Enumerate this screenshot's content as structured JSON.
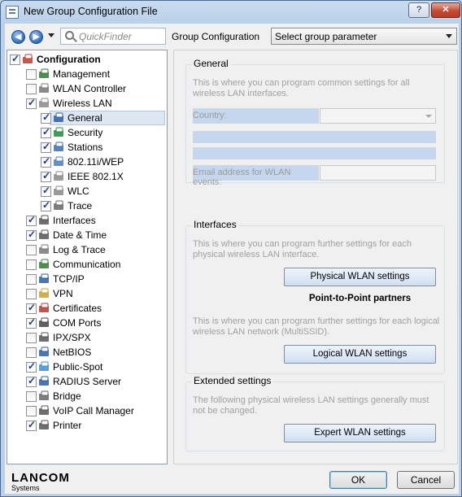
{
  "window": {
    "title": "New Group Configuration File",
    "help_label": "?",
    "close_label": "✕"
  },
  "toolbar": {
    "back_label": "◀",
    "forward_label": "▶",
    "quickfinder_placeholder": "QuickFinder",
    "group_label": "Group Configuration",
    "group_select_value": "Select group parameter"
  },
  "tree": {
    "items": [
      {
        "label": "Configuration",
        "checked": true,
        "icon": "configuration-icon",
        "bold": true,
        "level": 0
      },
      {
        "label": "Management",
        "checked": false,
        "icon": "management-icon",
        "level": 1
      },
      {
        "label": "WLAN Controller",
        "checked": false,
        "icon": "wlan-controller-icon",
        "level": 1
      },
      {
        "label": "Wireless LAN",
        "checked": true,
        "icon": "wireless-lan-icon",
        "level": 1
      },
      {
        "label": "General",
        "checked": true,
        "icon": "general-icon",
        "level": 2,
        "selected": true
      },
      {
        "label": "Security",
        "checked": true,
        "icon": "security-shield-icon",
        "level": 2
      },
      {
        "label": "Stations",
        "checked": true,
        "icon": "stations-icon",
        "level": 2
      },
      {
        "label": "802.11i/WEP",
        "checked": true,
        "icon": "wep-icon",
        "level": 2
      },
      {
        "label": "IEEE 802.1X",
        "checked": true,
        "icon": "ieee-icon",
        "level": 2
      },
      {
        "label": "WLC",
        "checked": true,
        "icon": "wlc-icon",
        "level": 2
      },
      {
        "label": "Trace",
        "checked": true,
        "icon": "trace-icon",
        "level": 2
      },
      {
        "label": "Interfaces",
        "checked": true,
        "icon": "interfaces-icon",
        "level": 1
      },
      {
        "label": "Date & Time",
        "checked": true,
        "icon": "clock-icon",
        "level": 1
      },
      {
        "label": "Log & Trace",
        "checked": false,
        "icon": "log-trace-icon",
        "level": 1
      },
      {
        "label": "Communication",
        "checked": false,
        "icon": "communication-icon",
        "level": 1
      },
      {
        "label": "TCP/IP",
        "checked": false,
        "icon": "tcpip-icon",
        "level": 1
      },
      {
        "label": "VPN",
        "checked": false,
        "icon": "lock-icon",
        "level": 1
      },
      {
        "label": "Certificates",
        "checked": true,
        "icon": "certificate-icon",
        "level": 1
      },
      {
        "label": "COM Ports",
        "checked": true,
        "icon": "com-ports-icon",
        "level": 1
      },
      {
        "label": "IPX/SPX",
        "checked": false,
        "icon": "ipx-icon",
        "level": 1
      },
      {
        "label": "NetBIOS",
        "checked": false,
        "icon": "netbios-icon",
        "level": 1
      },
      {
        "label": "Public-Spot",
        "checked": true,
        "icon": "public-spot-icon",
        "level": 1
      },
      {
        "label": "RADIUS Server",
        "checked": true,
        "icon": "radius-server-icon",
        "level": 1
      },
      {
        "label": "Bridge",
        "checked": false,
        "icon": "bridge-icon",
        "level": 1
      },
      {
        "label": "VoIP Call Manager",
        "checked": false,
        "icon": "voip-icon",
        "level": 1
      },
      {
        "label": "Printer",
        "checked": true,
        "icon": "printer-icon",
        "level": 1
      }
    ]
  },
  "general": {
    "title": "General",
    "desc": "This is where you can program common settings for all wireless LAN interfaces.",
    "country_label": "Country:",
    "email_label": "Email address for WLAN events:"
  },
  "interfaces": {
    "title": "Interfaces",
    "desc1": "This is where you can program further settings for each physical wireless LAN interface.",
    "physical_button": "Physical WLAN settings",
    "p2p_label": "Point-to-Point partners",
    "desc2": "This is where you can program further settings for each logical wireless LAN network (MultiSSID).",
    "logical_button": "Logical WLAN settings"
  },
  "extended": {
    "title": "Extended settings",
    "desc": "The following physical wireless LAN settings generally must not be changed.",
    "expert_button": "Expert WLAN settings"
  },
  "footer": {
    "logo_main": "LANCOM",
    "logo_sub": "Systems",
    "ok_label": "OK",
    "cancel_label": "Cancel"
  }
}
